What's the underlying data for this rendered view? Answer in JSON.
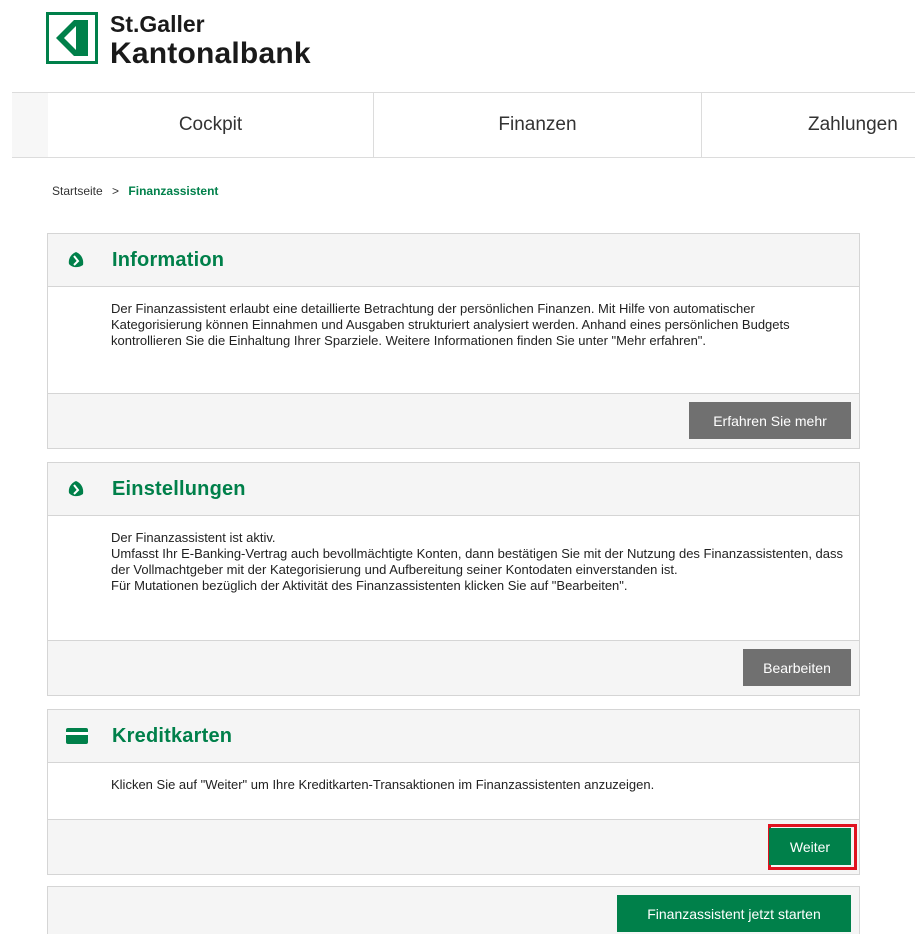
{
  "logo": {
    "line1": "St.Galler",
    "line2": "Kantonalbank"
  },
  "nav": {
    "tabs": [
      "Cockpit",
      "Finanzen",
      "Zahlungen"
    ]
  },
  "breadcrumb": {
    "home": "Startseite",
    "separator": ">",
    "current": "Finanzassistent"
  },
  "colors": {
    "brand_green": "#00804a",
    "button_gray": "#707070",
    "highlight_red": "#e0121f"
  },
  "panels": {
    "information": {
      "title": "Information",
      "icon": "info-leaf-icon",
      "text": "Der Finanzassistent erlaubt eine detaillierte Betrachtung der persönlichen Finanzen. Mit Hilfe von automatischer Kategorisierung können Einnahmen und Ausgaben strukturiert analysiert werden. Anhand eines persönlichen Budgets kontrollieren Sie die Einhaltung Ihrer Sparziele. Weitere Informationen finden Sie unter \"Mehr erfahren\".",
      "button": "Erfahren Sie mehr"
    },
    "settings": {
      "title": "Einstellungen",
      "icon": "settings-leaf-icon",
      "lines": [
        "Der Finanzassistent ist aktiv.",
        "Umfasst Ihr E-Banking-Vertrag auch bevollmächtigte Konten, dann bestätigen Sie mit der Nutzung des Finanzassistenten, dass der Vollmachtgeber mit der Kategorisierung und Aufbereitung seiner Kontodaten einverstanden ist.",
        "Für Mutationen bezüglich der Aktivität des Finanzassistenten klicken Sie auf \"Bearbeiten\"."
      ],
      "button": "Bearbeiten"
    },
    "creditcards": {
      "title": "Kreditkarten",
      "icon": "credit-card-icon",
      "text": "Klicken Sie auf \"Weiter\" um Ihre Kreditkarten-Transaktionen im Finanzassistenten anzuzeigen.",
      "button": "Weiter"
    },
    "start": {
      "button": "Finanzassistent jetzt starten"
    }
  }
}
